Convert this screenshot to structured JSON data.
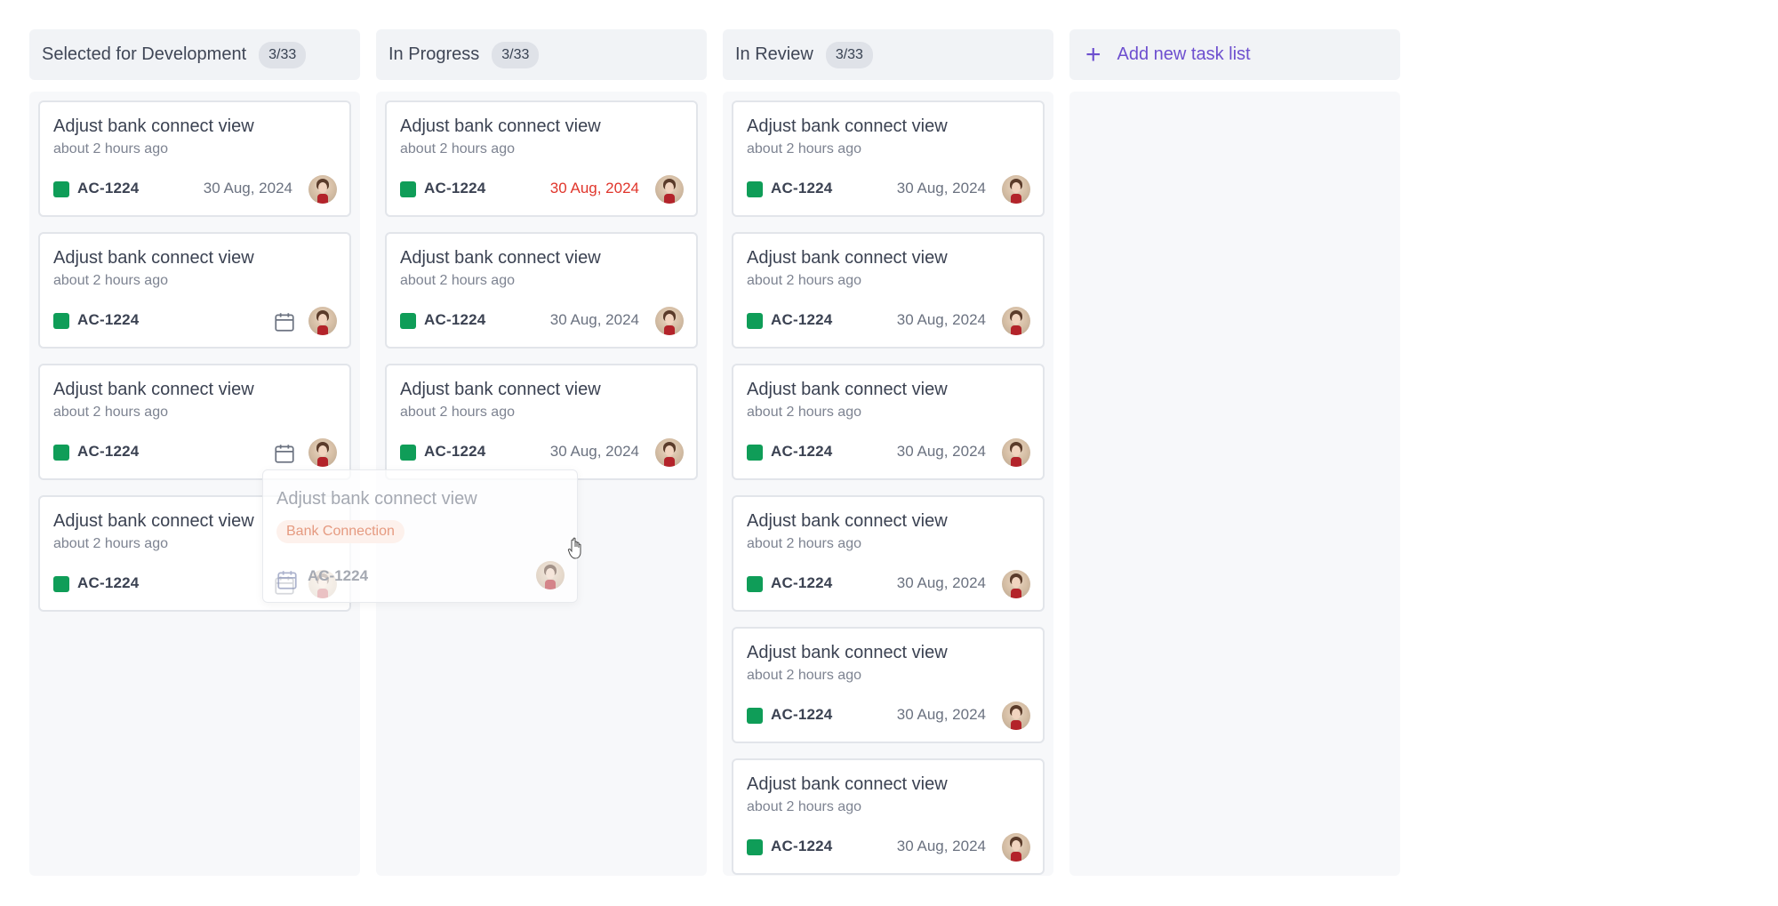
{
  "columns": [
    {
      "title": "Selected for Development",
      "count": "3/33",
      "cards": [
        {
          "title": "Adjust bank connect view",
          "time": "about 2 hours ago",
          "id": "AC-1224",
          "date": "30 Aug, 2024",
          "date_state": "normal",
          "show_calendar_icon": false
        },
        {
          "title": "Adjust bank connect view",
          "time": "about 2 hours ago",
          "id": "AC-1224",
          "date": "",
          "date_state": "none",
          "show_calendar_icon": true
        },
        {
          "title": "Adjust bank connect view",
          "time": "about 2 hours ago",
          "id": "AC-1224",
          "date": "",
          "date_state": "none",
          "show_calendar_icon": true
        },
        {
          "title": "Adjust bank connect view",
          "time": "about 2 hours ago",
          "id": "AC-1224",
          "date": "",
          "date_state": "none",
          "show_calendar_icon": true
        }
      ]
    },
    {
      "title": "In Progress",
      "count": "3/33",
      "cards": [
        {
          "title": "Adjust bank connect view",
          "time": "about 2 hours ago",
          "id": "AC-1224",
          "date": "30 Aug, 2024",
          "date_state": "overdue",
          "show_calendar_icon": false
        },
        {
          "title": "Adjust bank connect view",
          "time": "about 2 hours ago",
          "id": "AC-1224",
          "date": "30 Aug, 2024",
          "date_state": "normal",
          "show_calendar_icon": false
        },
        {
          "title": "Adjust bank connect view",
          "time": "about 2 hours ago",
          "id": "AC-1224",
          "date": "30 Aug, 2024",
          "date_state": "normal",
          "show_calendar_icon": false
        }
      ]
    },
    {
      "title": "In Review",
      "count": "3/33",
      "cards": [
        {
          "title": "Adjust bank connect view",
          "time": "about 2 hours ago",
          "id": "AC-1224",
          "date": "30 Aug, 2024",
          "date_state": "normal",
          "show_calendar_icon": false
        },
        {
          "title": "Adjust bank connect view",
          "time": "about 2 hours ago",
          "id": "AC-1224",
          "date": "30 Aug, 2024",
          "date_state": "normal",
          "show_calendar_icon": false
        },
        {
          "title": "Adjust bank connect view",
          "time": "about 2 hours ago",
          "id": "AC-1224",
          "date": "30 Aug, 2024",
          "date_state": "normal",
          "show_calendar_icon": false
        },
        {
          "title": "Adjust bank connect view",
          "time": "about 2 hours ago",
          "id": "AC-1224",
          "date": "30 Aug, 2024",
          "date_state": "normal",
          "show_calendar_icon": false
        },
        {
          "title": "Adjust bank connect view",
          "time": "about 2 hours ago",
          "id": "AC-1224",
          "date": "30 Aug, 2024",
          "date_state": "normal",
          "show_calendar_icon": false
        },
        {
          "title": "Adjust bank connect view",
          "time": "about 2 hours ago",
          "id": "AC-1224",
          "date": "30 Aug, 2024",
          "date_state": "normal",
          "show_calendar_icon": false
        }
      ]
    }
  ],
  "add_list": {
    "label": "Add new task list",
    "icon": "plus-icon"
  },
  "dragging_card": {
    "title": "Adjust bank connect view",
    "badge": "Bank Connection",
    "id": "AC-1224",
    "icon": "calendar-icon"
  },
  "colors": {
    "accent": "#6d4fcf",
    "tag": "#0f9d58",
    "overdue": "#e0352b",
    "badge_text": "#e59a80"
  }
}
